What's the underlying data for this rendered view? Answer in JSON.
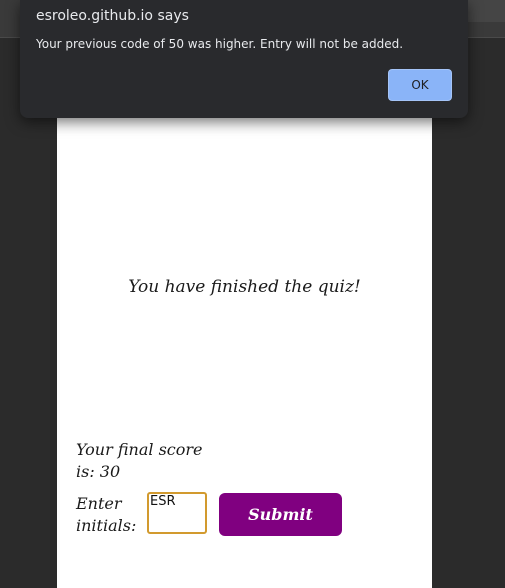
{
  "dialog": {
    "title": "esroleo.github.io says",
    "message": "Your previous code of 50 was higher. Entry will not be added.",
    "ok_label": "OK"
  },
  "quiz": {
    "finished_text": "You have finished the quiz!",
    "score_text": "Your final score is: 30",
    "initials_label": "Enter initials:",
    "initials_value": "ESR",
    "submit_label": "Submit"
  },
  "colors": {
    "submit_bg": "#800080",
    "input_border": "#d29a2e",
    "ok_bg": "#8ab4f8",
    "dialog_bg": "#292a2d"
  }
}
